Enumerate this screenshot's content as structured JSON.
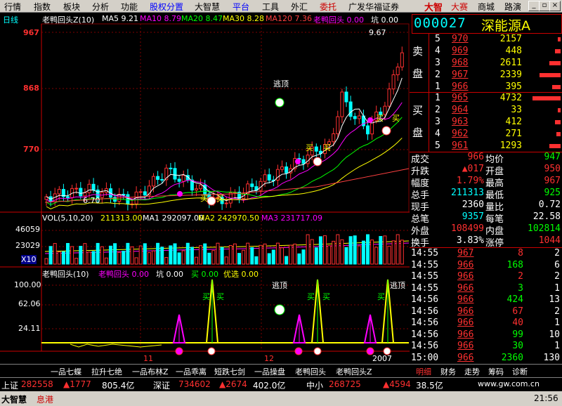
{
  "menu": {
    "items": [
      "行情",
      "指数",
      "板块",
      "分析",
      "功能",
      "股权分置",
      "大智慧",
      "平台",
      "工具",
      "外汇",
      "委托",
      "广发华福证券"
    ],
    "brand": "大智",
    "brand_tabs": [
      "大赛",
      "商城",
      "路演"
    ]
  },
  "main_chart": {
    "mode_label": "日线",
    "indicator_name": "老鸭回头Z(10)",
    "ma_legend": [
      {
        "name": "MA5",
        "value": "9.21",
        "color": "#ffffff"
      },
      {
        "name": "MA10",
        "value": "8.79",
        "color": "#ff00ff"
      },
      {
        "name": "MA20",
        "value": "8.47",
        "color": "#00ff00"
      },
      {
        "name": "MA30",
        "value": "8.28",
        "color": "#ffff00"
      },
      {
        "name": "MA120",
        "value": "7.36",
        "color": "#ff4040"
      }
    ],
    "extra_legend": [
      {
        "name": "老鸭回头",
        "value": "0.00",
        "color": "#ff00ff"
      },
      {
        "name": "坑",
        "value": "0.00",
        "color": "#ffffff"
      },
      {
        "name": "买",
        "value": "0.00",
        "color": "#00ff00"
      }
    ],
    "y_ticks": [
      "967",
      "868",
      "770"
    ],
    "high_label": "9.67",
    "low_label": "6.70",
    "annotations": {
      "top_sell": "逃顶",
      "buy": "买"
    }
  },
  "volume_chart": {
    "legend": "VOL(5,10,20)",
    "vol_value": "211313.00",
    "ma1_label": "MA1",
    "ma1_value": "292097.00",
    "ma2_label": "MA2",
    "ma2_value": "242970.50",
    "ma3_label": "MA3",
    "ma3_value": "231717.09",
    "y_ticks": [
      "46059",
      "23029",
      "X10"
    ]
  },
  "indicator_chart": {
    "legend_name": "老鸭回头(10)",
    "legend_items": [
      {
        "name": "老鸭回头",
        "value": "0.00",
        "color": "#ff00ff"
      },
      {
        "name": "坑",
        "value": "0.00",
        "color": "#ffffff"
      },
      {
        "name": "买",
        "value": "0.00",
        "color": "#00ff00"
      },
      {
        "name": "优选",
        "value": "0.00",
        "color": "#ffff00"
      }
    ],
    "y_ticks": [
      "100.00",
      "62.06",
      "24.11"
    ],
    "annotation_top": "逃顶",
    "annotation_buy": "买"
  },
  "x_axis": {
    "labels": [
      "11",
      "12",
      "2007"
    ]
  },
  "quote": {
    "code": "000027",
    "name": "深能源A",
    "sell_label": [
      "卖",
      "盘"
    ],
    "buy_label": [
      "买",
      "盘"
    ],
    "sell": [
      {
        "level": "5",
        "price": "970",
        "vol": "2157"
      },
      {
        "level": "4",
        "price": "969",
        "vol": "448"
      },
      {
        "level": "3",
        "price": "968",
        "vol": "2611"
      },
      {
        "level": "2",
        "price": "967",
        "vol": "2339"
      },
      {
        "level": "1",
        "price": "966",
        "vol": "395"
      }
    ],
    "buy": [
      {
        "level": "1",
        "price": "965",
        "vol": "4732"
      },
      {
        "level": "2",
        "price": "964",
        "vol": "33"
      },
      {
        "level": "3",
        "price": "963",
        "vol": "412"
      },
      {
        "level": "4",
        "price": "962",
        "vol": "271"
      },
      {
        "level": "5",
        "price": "961",
        "vol": "1293"
      }
    ],
    "stats": [
      {
        "l1": "成交",
        "v1": "966",
        "l2": "均价",
        "v2": "947"
      },
      {
        "l1": "升跌",
        "v1": "▲017",
        "l2": "开盘",
        "v2": "950"
      },
      {
        "l1": "幅度",
        "v1": "1.79%",
        "l2": "最高",
        "v2": "967"
      },
      {
        "l1": "总手",
        "v1": "211313",
        "l2": "最低",
        "v2": "925"
      },
      {
        "l1": "现手",
        "v1": "2360",
        "l2": "量比",
        "v2": "0.72"
      },
      {
        "l1": "总笔",
        "v1": "9357",
        "l2": "每笔",
        "v2": "22.58"
      },
      {
        "l1": "外盘",
        "v1": "108499",
        "l2": "内盘",
        "v2": "102814"
      },
      {
        "l1": "换手",
        "v1": "3.83%",
        "l2": "涨停",
        "v2": "1044"
      }
    ],
    "ticks": [
      {
        "time": "14:55",
        "price": "967",
        "vol": "8",
        "n": "2"
      },
      {
        "time": "14:55",
        "price": "966",
        "vol": "168",
        "n": "6"
      },
      {
        "time": "14:55",
        "price": "966",
        "vol": "2",
        "n": "2"
      },
      {
        "time": "14:55",
        "price": "966",
        "vol": "3",
        "n": "1"
      },
      {
        "time": "14:56",
        "price": "966",
        "vol": "424",
        "n": "13"
      },
      {
        "time": "14:56",
        "price": "966",
        "vol": "67",
        "n": "2"
      },
      {
        "time": "14:56",
        "price": "966",
        "vol": "40",
        "n": "1"
      },
      {
        "time": "14:56",
        "price": "966",
        "vol": "99",
        "n": "10"
      },
      {
        "time": "14:56",
        "price": "966",
        "vol": "30",
        "n": "1"
      },
      {
        "time": "15:00",
        "price": "966",
        "vol": "2360",
        "n": "130"
      }
    ]
  },
  "bottom_tabs": [
    "一品七蝶",
    "拉升七绝",
    "一品布林Z",
    "一品乖离",
    "短跌七剑",
    "一品操盘",
    "老鸭回头",
    "老鸭回头Z"
  ],
  "right_tabs": [
    "明细",
    "财务",
    "走势",
    "筹码",
    "诊断"
  ],
  "status": {
    "sh_label": "上证",
    "sh_value": "282558",
    "sh_change": "▲1777",
    "sh_amount": "805.4亿",
    "sz_label": "深证",
    "sz_value": "734602",
    "sz_change": "▲2674",
    "sz_amount": "402.0亿",
    "zx_label": "中小",
    "zx_value": "268725",
    "zx_change": "▲4594",
    "zx_amount": "38.5亿",
    "url": "www.gw.com.cn"
  },
  "status2": {
    "brand": "大智慧",
    "msg": "息港",
    "time": "21:56"
  },
  "colors": {
    "up": "#ff3030",
    "down": "#00ffff",
    "ma5": "#ffffff",
    "ma10": "#ff00ff",
    "ma20": "#00ff00",
    "ma30": "#ffff00",
    "ma120": "#ff4040",
    "label": "#ff3030"
  }
}
